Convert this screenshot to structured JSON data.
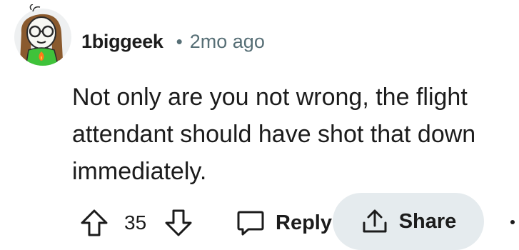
{
  "comment": {
    "author": "1biggeek",
    "separator": "•",
    "age": "2mo ago",
    "lines": [
      "Not only are you not wrong, the flight",
      "attendant should have shot that down",
      "immediately."
    ]
  },
  "actions": {
    "score": "35",
    "reply_label": "Reply",
    "share_label": "Share"
  },
  "icons": {
    "upvote": "arrow-up-outline-icon",
    "downvote": "arrow-down-outline-icon",
    "reply": "speech-bubble-icon",
    "share": "share-upload-icon",
    "more": "overflow-dots-icon"
  },
  "colors": {
    "text": "#1c1c1c",
    "meta": "#576f76",
    "pill": "#e5ebee",
    "avatar_shirt": "#3fc23a"
  }
}
